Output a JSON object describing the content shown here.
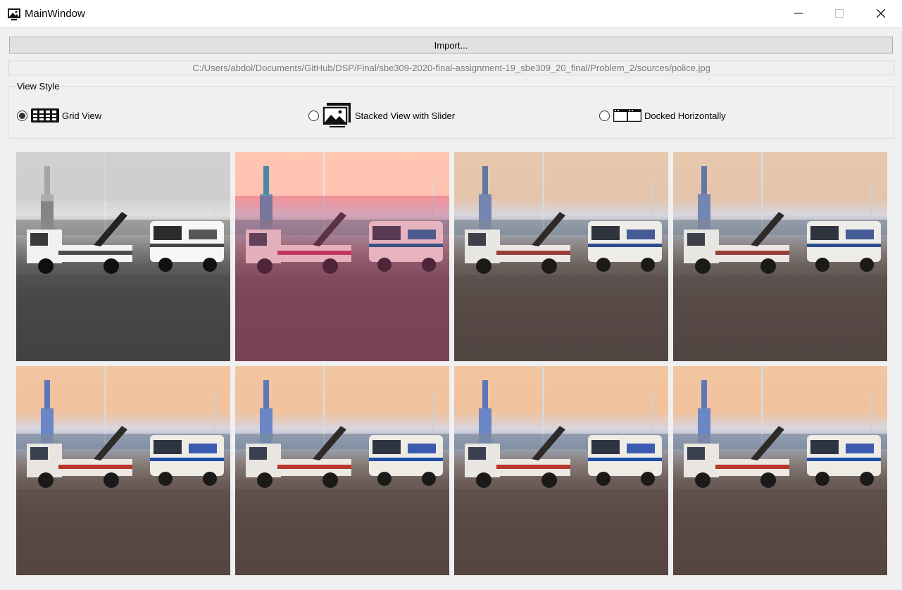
{
  "window": {
    "title": "MainWindow",
    "icons": {
      "app": "picture-icon",
      "minimize": "minimize-icon",
      "maximize": "maximize-icon",
      "close": "close-icon"
    }
  },
  "toolbar": {
    "import_label": "Import...",
    "file_path": "C:/Users/abdol/Documents/GitHub/DSP/Final/sbe309-2020-final-assignment-19_sbe309_20_final/Problem_2/sources/police.jpg"
  },
  "view_style": {
    "title": "View Style",
    "options": [
      {
        "label": "Grid View",
        "icon": "grid-icon",
        "selected": true
      },
      {
        "label": "Stacked View with Slider",
        "icon": "stacked-images-icon",
        "selected": false
      },
      {
        "label": "Docked Horizontally",
        "icon": "docked-horizontal-icon",
        "selected": false
      }
    ]
  },
  "grid": {
    "rows": 2,
    "columns": 4,
    "images": [
      {
        "content": "police-tow-truck-photo",
        "variant": "grayscale-pixelated-pink-top"
      },
      {
        "content": "police-tow-truck-photo",
        "variant": "rose-tinted-pixelated"
      },
      {
        "content": "police-tow-truck-photo",
        "variant": "low-resolution-color"
      },
      {
        "content": "police-tow-truck-photo",
        "variant": "low-resolution-color"
      },
      {
        "content": "police-tow-truck-photo",
        "variant": "slightly-blurred-color"
      },
      {
        "content": "police-tow-truck-photo",
        "variant": "slightly-blurred-color"
      },
      {
        "content": "police-tow-truck-photo",
        "variant": "full-resolution-color"
      },
      {
        "content": "police-tow-truck-photo",
        "variant": "full-resolution-color"
      }
    ]
  }
}
